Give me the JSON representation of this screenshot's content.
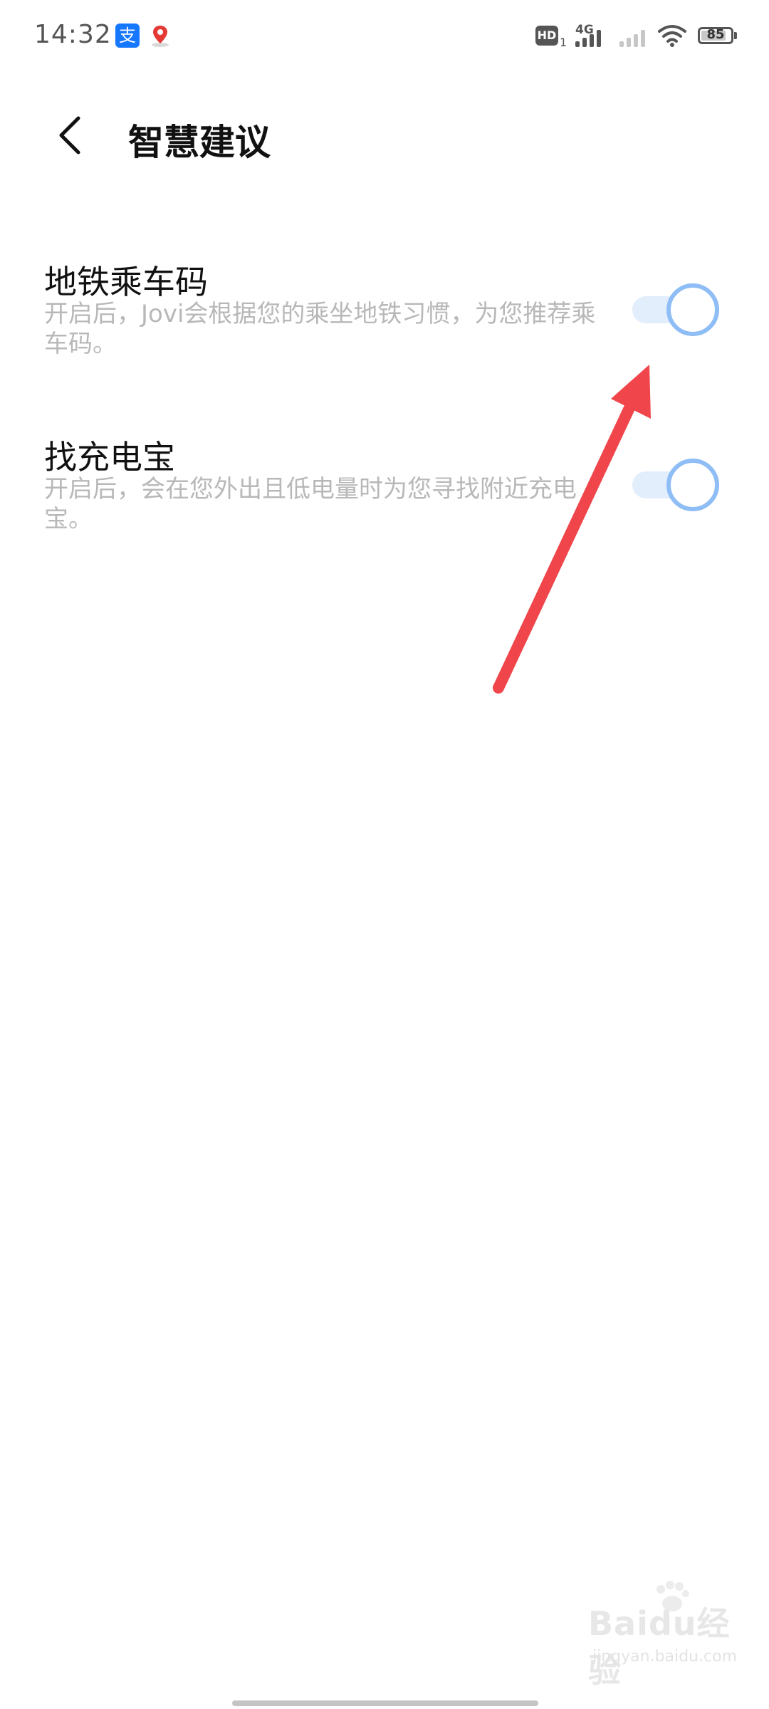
{
  "status_bar": {
    "time": "14:32",
    "notification_icons": [
      "alipay-icon",
      "map-pin-icon"
    ],
    "alipay_glyph": "支",
    "hd_label": "HD",
    "hd_sub": "1",
    "network_label": "4G",
    "battery_level": "85",
    "battery_fraction": 0.85
  },
  "header": {
    "title": "智慧建议",
    "back_icon": "chevron-left-icon"
  },
  "settings": [
    {
      "title": "地铁乘车码",
      "description": "开启后，Jovi会根据您的乘坐地铁习惯，为您推荐乘车码。",
      "enabled": true
    },
    {
      "title": "找充电宝",
      "description": "开启后，会在您外出且低电量时为您寻找附近充电宝。",
      "enabled": true
    }
  ],
  "annotation": {
    "color": "#f0454a"
  },
  "colors": {
    "toggle_track": "#e3eefc",
    "toggle_knob_border": "#8fbdf5",
    "alipay_blue": "#1677ff"
  },
  "watermark": {
    "logo_text": "Baidu经验",
    "sub_text": "jingyan.baidu.com"
  }
}
